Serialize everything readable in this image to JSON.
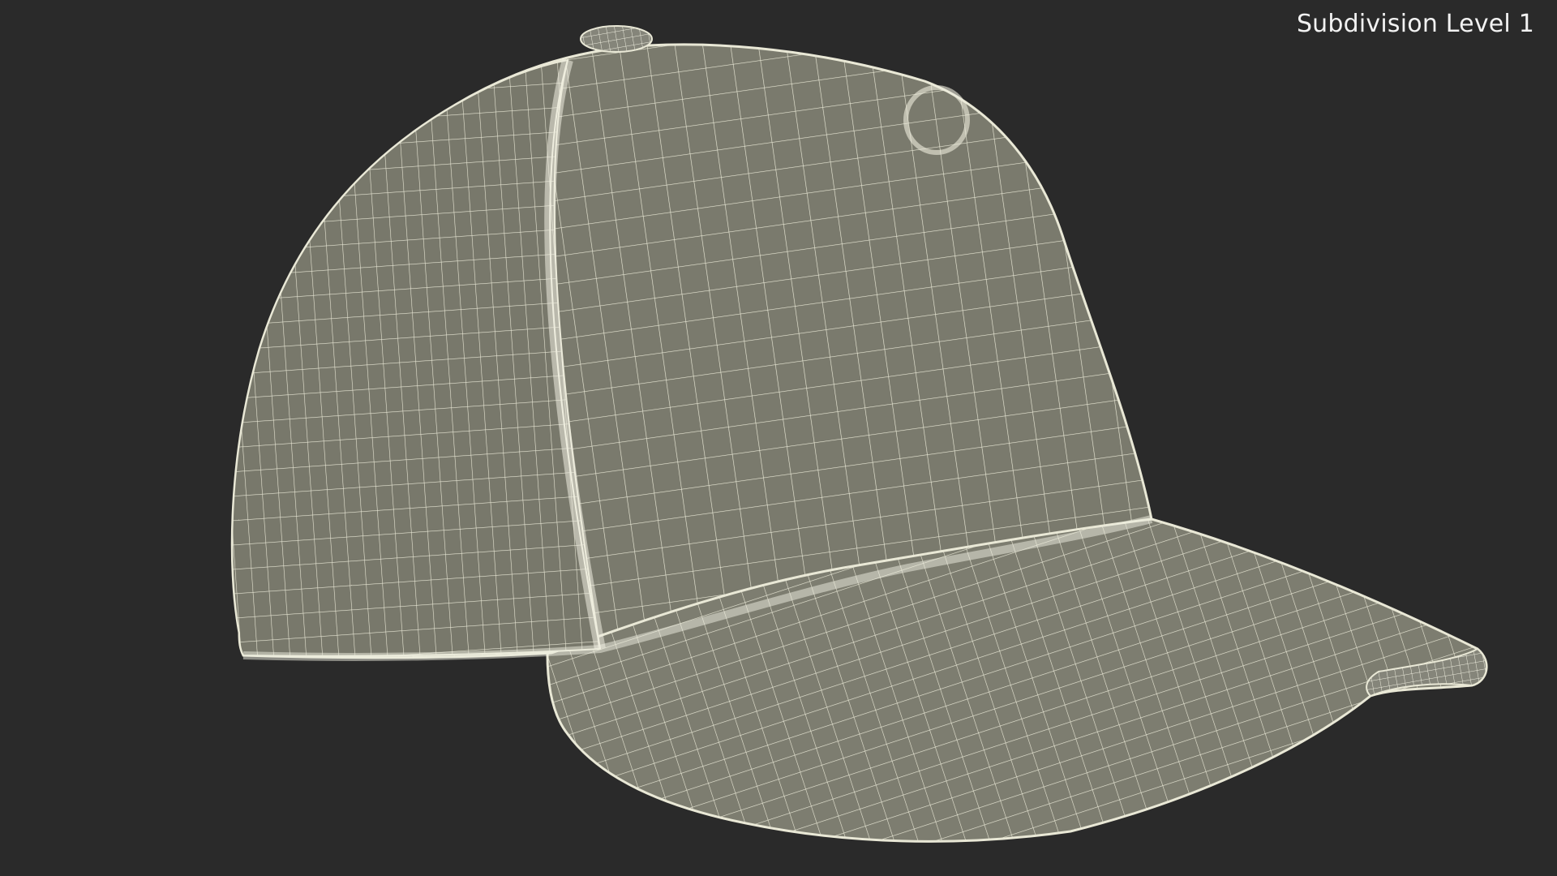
{
  "viewport": {
    "label": "Subdivision Level 1",
    "background": "#2a2a2a",
    "mesh_fill": "#7b7b6e",
    "mesh_wire": "#e9e8d6"
  },
  "subject": {
    "name": "baseball-cap-wireframe"
  }
}
